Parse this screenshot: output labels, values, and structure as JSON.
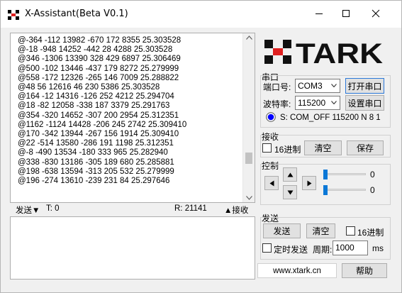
{
  "window": {
    "title": "X-Assistant(Beta V0.1)",
    "min_icon": "minimize-icon",
    "max_icon": "maximize-icon",
    "close_icon": "close-icon"
  },
  "receive_log": {
    "lines": [
      "@-364 -112 13982 -670 172 8355 25.303528",
      "@-18 -948 14252 -442 28 4288 25.303528",
      "@346 -1306 13390 328 429 6897 25.306469",
      "@500 -102 13446 -437 179 8272 25.279999",
      "@558 -172 12326 -265 146 7009 25.288822",
      "@48 56 12616 46 230 5386 25.303528",
      "@164 -12 14316 -126 252 4212 25.294704",
      "@18 -82 12058 -338 187 3379 25.291763",
      "@354 -320 14652 -307 200 2954 25.312351",
      "@1162 -1124 14428 -206 245 2742 25.309410",
      "@170 -342 13944 -267 156 1914 25.309410",
      "@22 -514 13580 -286 191 1198 25.312351",
      "@-8 -490 13534 -180 333 965 25.282940",
      "@338 -830 13186 -305 189 680 25.285881",
      "@198 -638 13594 -313 205 532 25.279999",
      "@196 -274 13610 -239 231 84 25.297646"
    ]
  },
  "status_bar": {
    "send_toggle": "发送▼",
    "t_label": "T:  0",
    "r_label": "R:  21141",
    "recv_toggle": "▲接收"
  },
  "logo_text": "TARK",
  "serial": {
    "group_title": "串口",
    "port_label": "端口号:",
    "port_value": "COM3",
    "open_button": "打开串口",
    "baud_label": "波特率:",
    "baud_value": "115200",
    "settings_button": "设置串口",
    "status_text": "S: COM_OFF 115200 N 8 1",
    "status_color": "#0000ff"
  },
  "receive": {
    "group_title": "接收",
    "hex_label": "16进制",
    "hex_checked": false,
    "clear_button": "清空",
    "save_button": "保存"
  },
  "control": {
    "group_title": "控制",
    "slider1_value": "0",
    "slider2_value": "0",
    "accent": "#0b78d7"
  },
  "send": {
    "group_title": "发送",
    "send_button": "发送",
    "clear_button": "清空",
    "hex_label": "16进制",
    "hex_checked": false,
    "timed_label": "定时发送",
    "timed_checked": false,
    "period_label": "周期:",
    "period_value": "1000",
    "unit_label": "ms"
  },
  "footer": {
    "website": "www.xtark.cn",
    "help_button": "帮助"
  }
}
